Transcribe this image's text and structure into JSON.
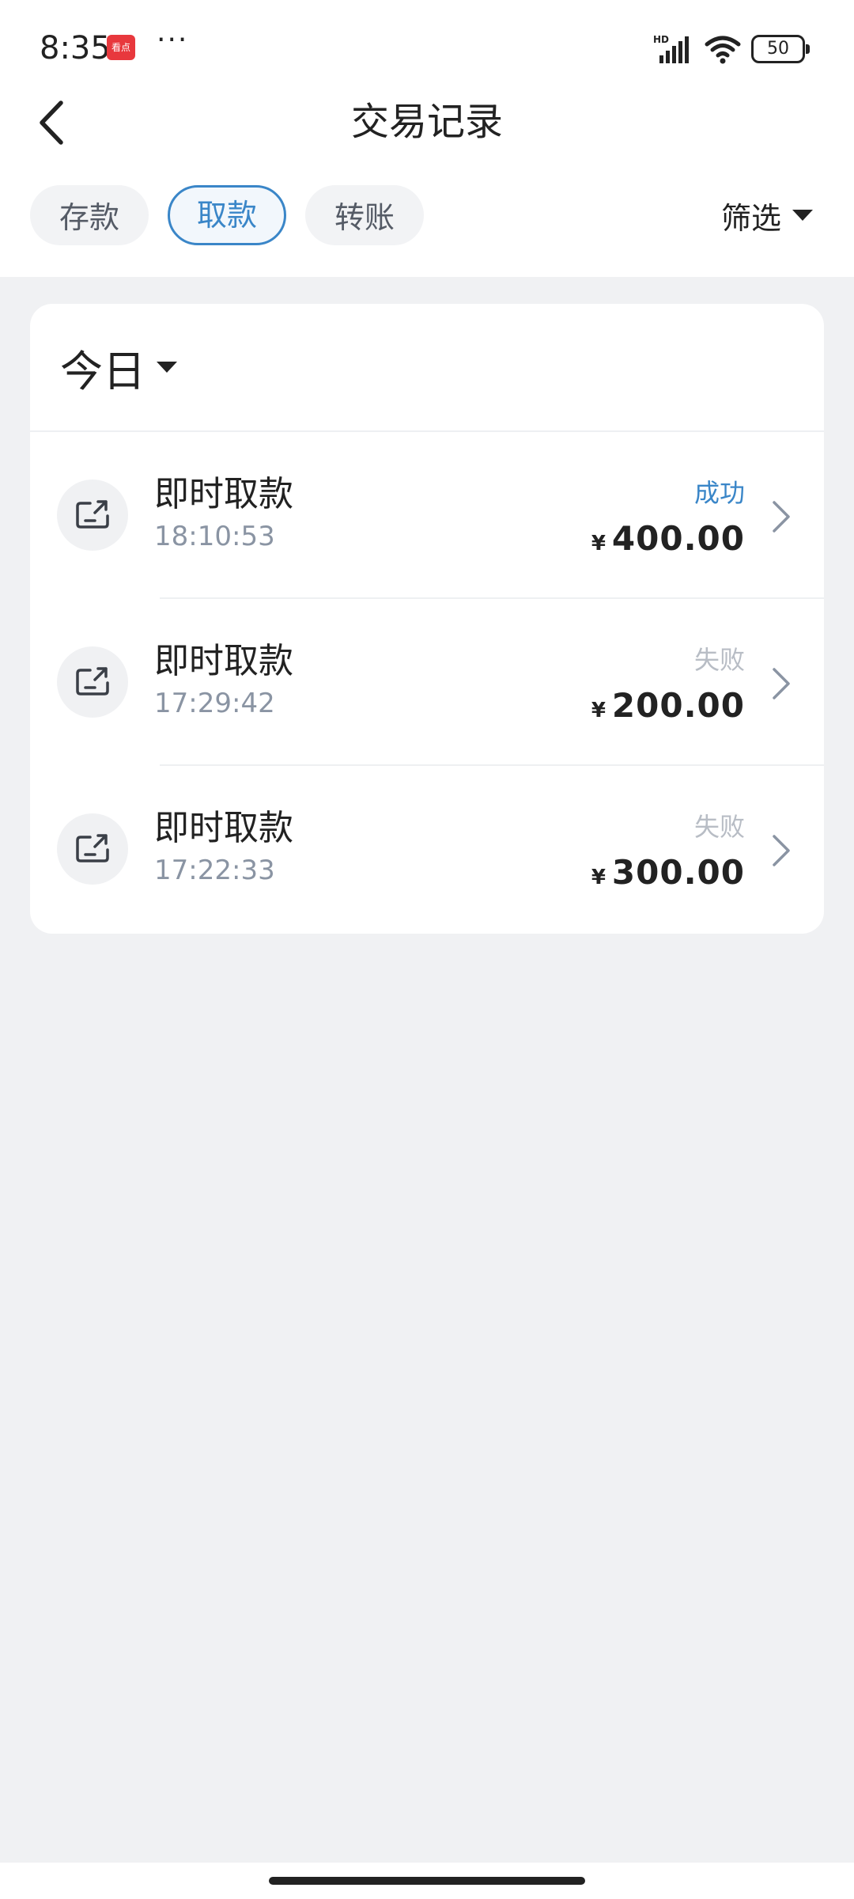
{
  "status_bar": {
    "time": "8:35",
    "app_badge": "看点",
    "more": "···",
    "battery": "50"
  },
  "nav": {
    "title": "交易记录"
  },
  "tabs": [
    {
      "label": "存款",
      "active": false
    },
    {
      "label": "取款",
      "active": true
    },
    {
      "label": "转账",
      "active": false
    }
  ],
  "filter": {
    "label": "筛选"
  },
  "section": {
    "title": "今日"
  },
  "transactions": [
    {
      "name": "即时取款",
      "time": "18:10:53",
      "status": "成功",
      "currency": "¥",
      "amount": "400.00"
    },
    {
      "name": "即时取款",
      "time": "17:29:42",
      "status": "失败",
      "currency": "¥",
      "amount": "200.00"
    },
    {
      "name": "即时取款",
      "time": "17:22:33",
      "status": "失败",
      "currency": "¥",
      "amount": "300.00"
    }
  ],
  "colors": {
    "accent": "#3a86c8",
    "background": "#f0f1f3",
    "failed": "#b8bdc5"
  }
}
